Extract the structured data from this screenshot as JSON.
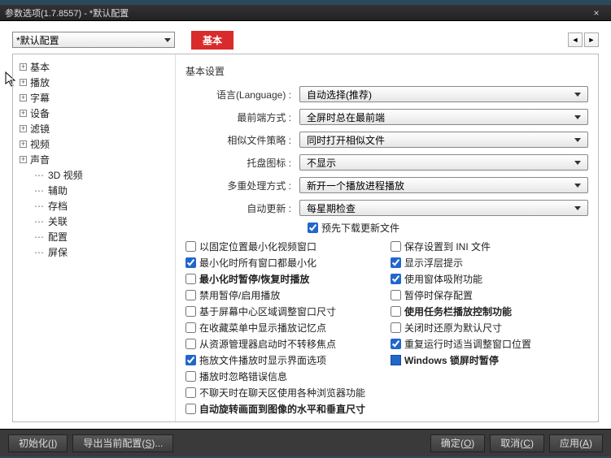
{
  "window": {
    "title": "参数选项(1.7.8557) - *默认配置",
    "close_icon": "×"
  },
  "profile": {
    "selected": "*默认配置"
  },
  "tab": {
    "label": "基本"
  },
  "pager": {
    "prev": "◄",
    "next": "►"
  },
  "tree": {
    "items": [
      {
        "label": "基本",
        "expandable": true
      },
      {
        "label": "播放",
        "expandable": true
      },
      {
        "label": "字幕",
        "expandable": true
      },
      {
        "label": "设备",
        "expandable": true
      },
      {
        "label": "滤镜",
        "expandable": true
      },
      {
        "label": "视频",
        "expandable": true
      },
      {
        "label": "声音",
        "expandable": true
      },
      {
        "label": "3D 视频",
        "expandable": false
      },
      {
        "label": "辅助",
        "expandable": false
      },
      {
        "label": "存档",
        "expandable": false
      },
      {
        "label": "关联",
        "expandable": false
      },
      {
        "label": "配置",
        "expandable": false
      },
      {
        "label": "屏保",
        "expandable": false
      }
    ]
  },
  "group": {
    "title": "基本设置"
  },
  "form": {
    "language": {
      "label": "语言(Language) :",
      "value": "自动选择(推荐)"
    },
    "foremost": {
      "label": "最前端方式 :",
      "value": "全屏时总在最前端"
    },
    "similar": {
      "label": "相似文件策略 :",
      "value": "同时打开相似文件"
    },
    "tray": {
      "label": "托盘图标 :",
      "value": "不显示"
    },
    "multi": {
      "label": "多重处理方式 :",
      "value": "新开一个播放进程播放"
    },
    "update": {
      "label": "自动更新 :",
      "value": "每星期检查"
    },
    "precheck": {
      "label": "预先下载更新文件",
      "checked": true
    }
  },
  "checks": {
    "left": [
      {
        "label": "以固定位置最小化视频窗口",
        "checked": false,
        "bold": false
      },
      {
        "label": "最小化时所有窗口都最小化",
        "checked": true,
        "bold": false
      },
      {
        "label": "最小化时暂停/恢复时播放",
        "checked": false,
        "bold": true
      },
      {
        "label": "禁用暂停/启用播放",
        "checked": false,
        "bold": false
      },
      {
        "label": "基于屏幕中心区域调整窗口尺寸",
        "checked": false,
        "bold": false
      },
      {
        "label": "在收藏菜单中显示播放记忆点",
        "checked": false,
        "bold": false
      },
      {
        "label": "从资源管理器启动时不转移焦点",
        "checked": false,
        "bold": false
      },
      {
        "label": "拖放文件播放时显示界面选项",
        "checked": true,
        "bold": false
      },
      {
        "label": "播放时忽略错误信息",
        "checked": false,
        "bold": false
      },
      {
        "label": "不聊天时在聊天区使用各种浏览器功能",
        "checked": false,
        "bold": false
      },
      {
        "label": "自动旋转画面到图像的水平和垂直尺寸",
        "checked": false,
        "bold": true
      }
    ],
    "right": [
      {
        "label": "保存设置到 INI 文件",
        "checked": false,
        "bold": false
      },
      {
        "label": "显示浮层提示",
        "checked": true,
        "bold": false
      },
      {
        "label": "使用窗体吸附功能",
        "checked": true,
        "bold": false
      },
      {
        "label": "暂停时保存配置",
        "checked": false,
        "bold": false
      },
      {
        "label": "使用任务栏播放控制功能",
        "checked": false,
        "bold": true
      },
      {
        "label": "关闭时还原为默认尺寸",
        "checked": false,
        "bold": false
      },
      {
        "label": "重复运行时适当调整窗口位置",
        "checked": true,
        "bold": false
      },
      {
        "label": "Windows 锁屏时暂停",
        "checked": "blue",
        "bold": true
      }
    ]
  },
  "footer": {
    "init": {
      "text": "初始化",
      "key": "I"
    },
    "export": {
      "text": "导出当前配置",
      "key": "S",
      "suffix": "..."
    },
    "ok": {
      "text": "确定",
      "key": "O"
    },
    "cancel": {
      "text": "取消",
      "key": "C"
    },
    "apply": {
      "text": "应用",
      "key": "A"
    }
  }
}
